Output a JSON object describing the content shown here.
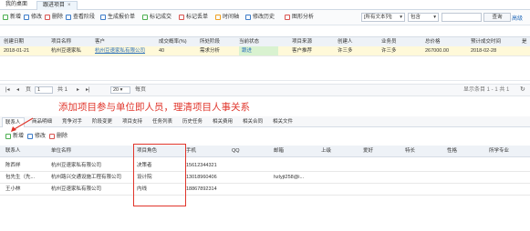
{
  "tabs": [
    {
      "label": "我的桌面",
      "active": false
    },
    {
      "label": "跟进项目",
      "active": true,
      "close": "×"
    }
  ],
  "toolbar": {
    "buttons": [
      "新增",
      "修改",
      "删除",
      "查看阶段",
      "生成报价单",
      "标记成交",
      "标记丢单",
      "时间轴",
      "修改历史",
      "图形分析"
    ],
    "search_scope": "[所有文本列]",
    "match_mode": "包含",
    "search_value": "",
    "query_label": "查询",
    "advanced_label": "高级"
  },
  "grid": {
    "headers": [
      "创建日期",
      "项目名称",
      "客户",
      "成交概率(%)",
      "所处阶段",
      "当前状态",
      "项目来源",
      "创建人",
      "业务员",
      "总价格",
      "预计成交时间",
      "是"
    ],
    "row": [
      "2018-01-21",
      "杭州豆速家私",
      "杭州豆速家私有限公司",
      "40",
      "需求分析",
      "跟进",
      "客户推荐",
      "许三多",
      "许三多",
      "267000.00",
      "2018-02-28",
      ""
    ]
  },
  "pager": {
    "page_label": "页",
    "page_value": "1",
    "total_pages": "共 1",
    "page_size": "20",
    "per_page_label": "每页",
    "status": "显示条目 1 - 1  共 1"
  },
  "annotation": "添加项目参与单位即人员，理清项目人事关系",
  "subtabs": [
    "联系人",
    "商品明细",
    "竞争对手",
    "阶段变更",
    "项目支持",
    "任务列表",
    "历史任务",
    "相关费用",
    "相关合同",
    "相关文件"
  ],
  "subtool": [
    "新增",
    "修改",
    "删除"
  ],
  "contacts": {
    "headers": [
      "联系人",
      "单位名称",
      "项目角色",
      "手机",
      "QQ",
      "邮箱",
      "上级",
      "爱好",
      "特长",
      "性格",
      "所学专业"
    ],
    "rows": [
      [
        "陈西祥",
        "杭州豆速家私有限公司",
        "决策者",
        "15612344321",
        "",
        "",
        "",
        "",
        "",
        "",
        ""
      ],
      [
        "包先生（先...",
        "杭州路兴交通设施工程有限公司",
        "设计院",
        "13018960406",
        "",
        "hzlyjt258@i...",
        "",
        "",
        "",
        "",
        ""
      ],
      [
        "王小林",
        "杭州豆速家私有限公司",
        "内线",
        "18867892314",
        "",
        "",
        "",
        "",
        "",
        "",
        ""
      ]
    ]
  },
  "colors": {
    "accent": "#2a6ebb",
    "annotation": "#e0352b",
    "row_highlight": "#fff9d9"
  }
}
